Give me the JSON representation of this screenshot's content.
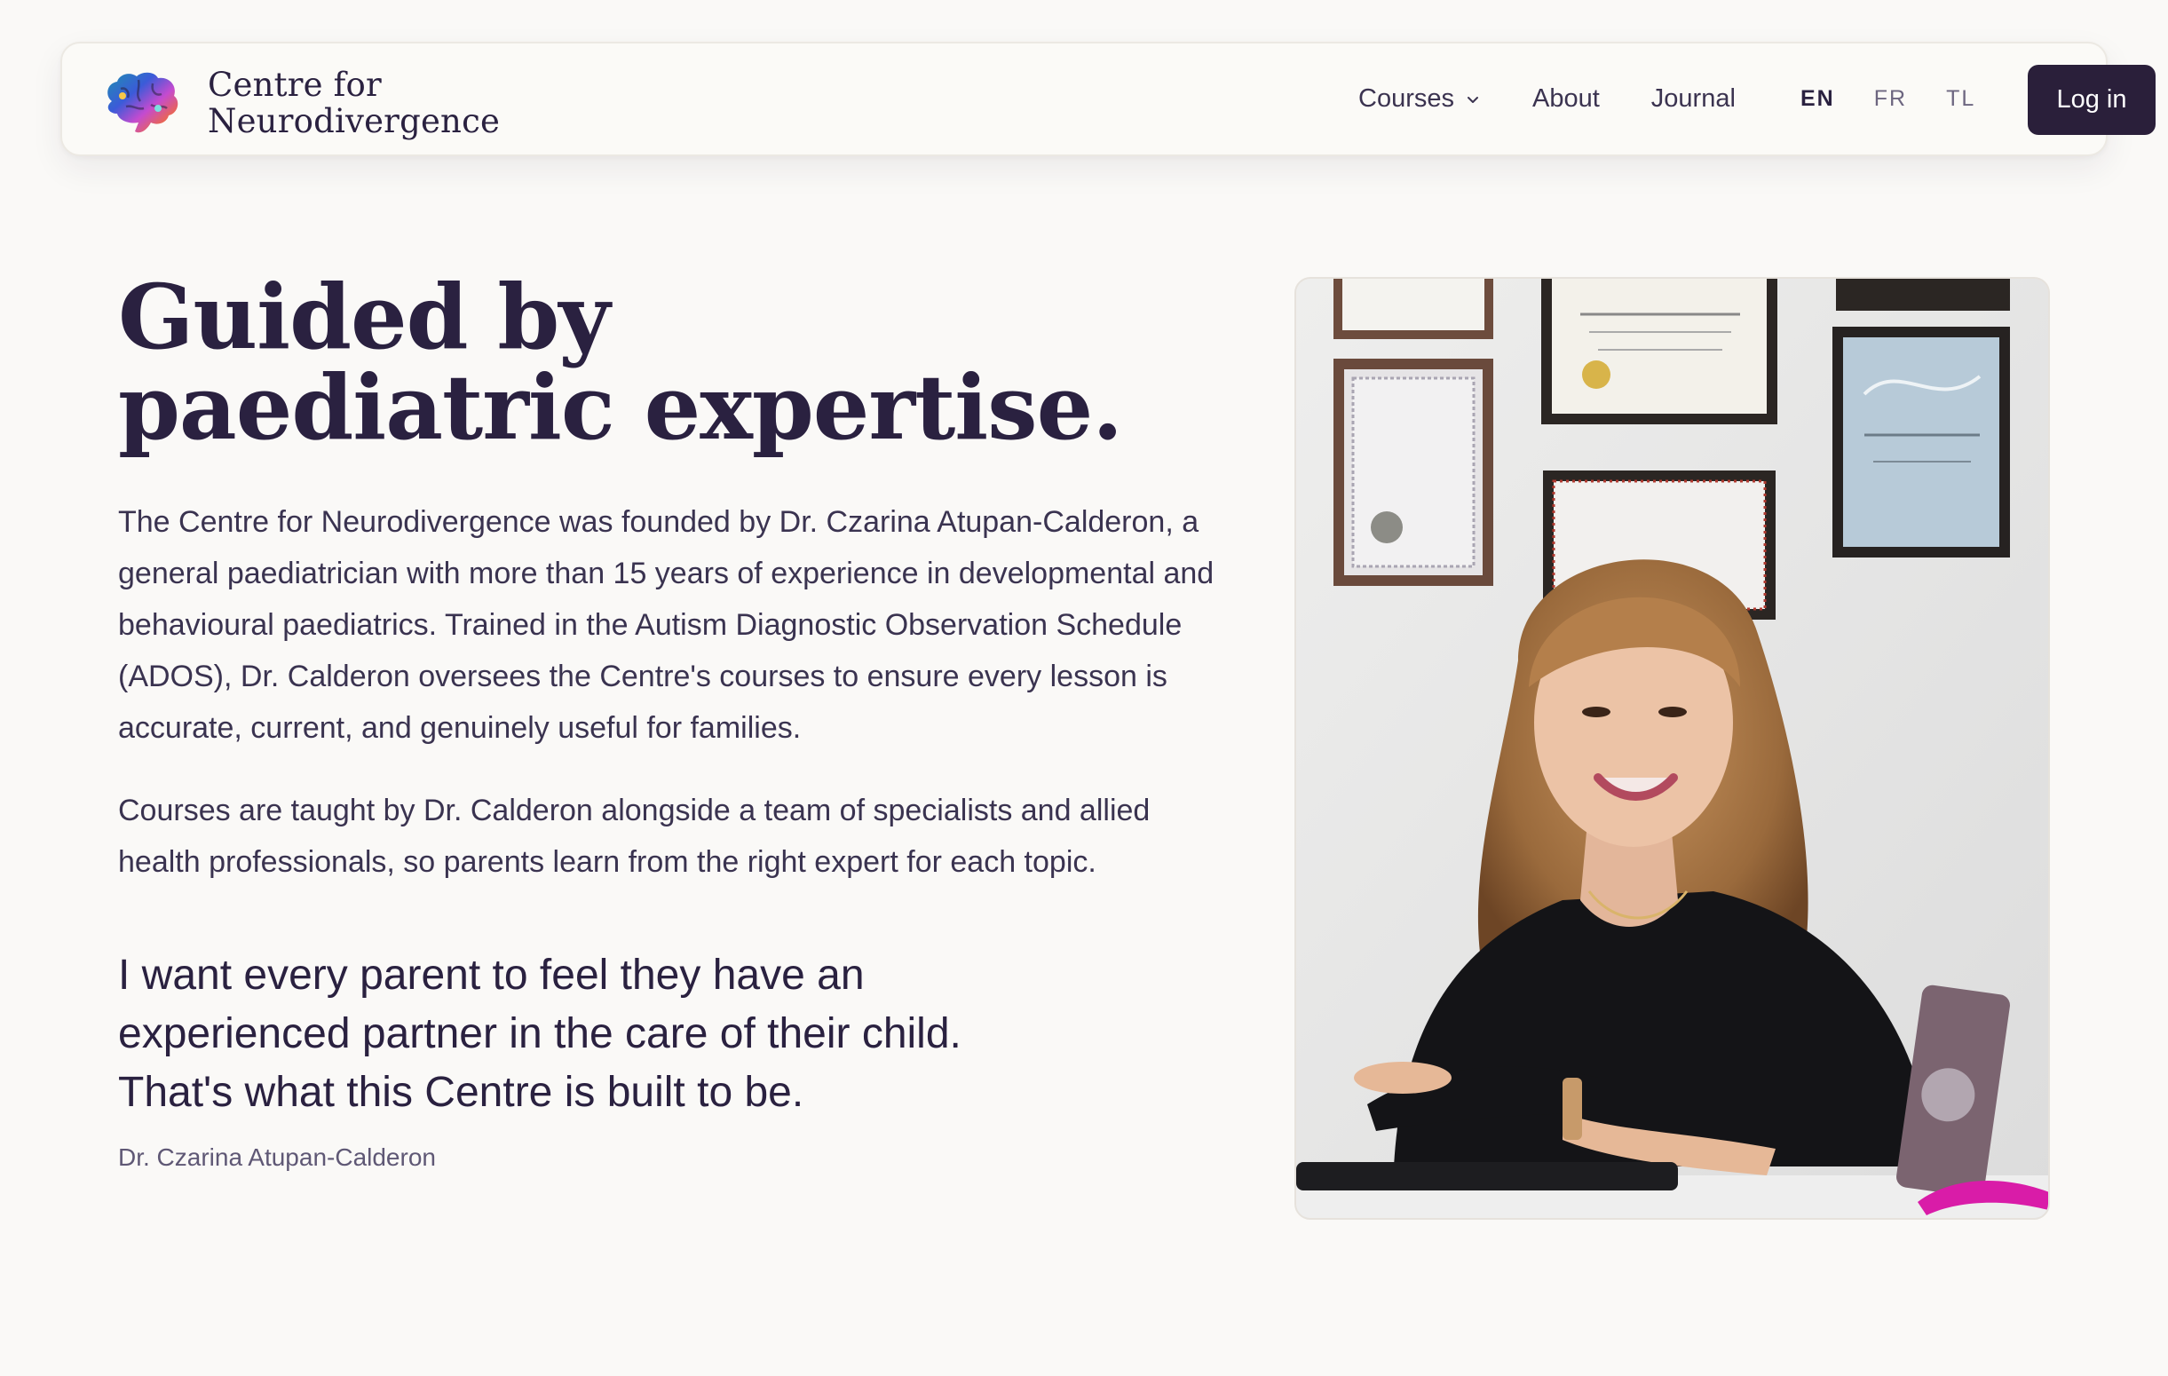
{
  "brand": {
    "logo_icon": "brain-icon",
    "name_line1": "Centre for",
    "name_line2": "Neurodivergence"
  },
  "nav": {
    "items": [
      {
        "label": "Courses",
        "has_dropdown": true
      },
      {
        "label": "About"
      },
      {
        "label": "Journal"
      }
    ],
    "languages": [
      {
        "code": "EN",
        "active": true
      },
      {
        "code": "FR",
        "active": false
      },
      {
        "code": "TL",
        "active": false
      }
    ],
    "login_label": "Log in"
  },
  "hero": {
    "headline_line1": "Guided by",
    "headline_line2": "paediatric expertise.",
    "paragraph1": "The Centre for Neurodivergence was founded by Dr. Czarina Atupan-Calderon, a general paediatrician with more than 15 years of experience in developmental and behavioural paediatrics. Trained in the Autism Diagnostic Observation Schedule (ADOS), Dr. Calderon oversees the Centre's courses to ensure every lesson is accurate, current, and genuinely useful for families.",
    "paragraph2": "Courses are taught by Dr. Calderon alongside a team of specialists and allied health professionals, so parents learn from the right expert for each topic.",
    "quote": "I want every parent to feel they have an experienced partner in the care of their child. That's what this Centre is built to be.",
    "quote_author": "Dr. Czarina Atupan-Calderon"
  },
  "colors": {
    "background": "#faf9f7",
    "primary_text": "#2a2140",
    "button_bg": "#2a1f3a",
    "button_text": "#ffffff"
  }
}
